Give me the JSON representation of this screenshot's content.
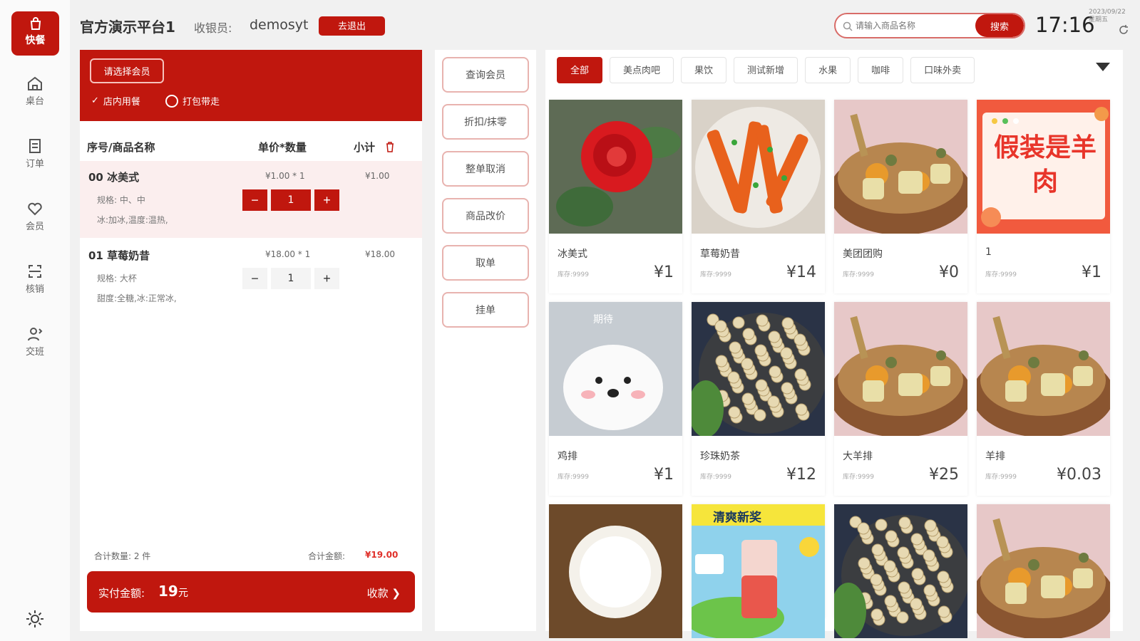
{
  "app": {
    "logo_label": "快餐",
    "title": "官方演示平台1",
    "cashier_label": "收银员:",
    "cashier_name": "demosyt",
    "logout_label": "去退出"
  },
  "nav": [
    {
      "label": "桌台",
      "icon": "home-icon"
    },
    {
      "label": "订单",
      "icon": "order-icon"
    },
    {
      "label": "会员",
      "icon": "heart-icon"
    },
    {
      "label": "核销",
      "icon": "scan-icon"
    },
    {
      "label": "交班",
      "icon": "user-switch-icon"
    }
  ],
  "search": {
    "placeholder": "请输入商品名称",
    "button_label": "搜索"
  },
  "clock": {
    "time": "17:16",
    "date": "2023/09/22",
    "weekday": "星期五"
  },
  "order": {
    "select_member_label": "请选择会员",
    "dine_in_label": "店内用餐",
    "takeaway_label": "打包带走",
    "columns": {
      "name": "序号/商品名称",
      "price_qty": "单价*数量",
      "subtotal": "小计"
    },
    "items": [
      {
        "name": "00 冰美式",
        "price_qty": "¥1.00 * 1",
        "subtotal": "¥1.00",
        "spec": "规格: 中、中",
        "note": "冰:加冰,温度:温热,",
        "qty": "1"
      },
      {
        "name": "01 草莓奶昔",
        "price_qty": "¥18.00 * 1",
        "subtotal": "¥18.00",
        "spec": "规格: 大杯",
        "note": "甜度:全糖,冰:正常冰,",
        "qty": "1"
      }
    ],
    "total_qty_label": "合计数量: 2 件",
    "total_amount_label": "合计金额:",
    "total_amount": "¥19.00",
    "pay_label": "实付金额:",
    "pay_amount": "19",
    "pay_unit": "元",
    "checkout_label": "收款 ❯"
  },
  "actions": [
    "查询会员",
    "折扣/抹零",
    "整单取消",
    "商品改价",
    "取单",
    "挂单"
  ],
  "categories": [
    "全部",
    "美点肉吧",
    "果饮",
    "测试新增",
    "水果",
    "咖啡",
    "口味外卖"
  ],
  "products": [
    {
      "name": "冰美式",
      "stock": "库存:9999",
      "price": "¥1"
    },
    {
      "name": "草莓奶昔",
      "stock": "库存:9999",
      "price": "¥14"
    },
    {
      "name": "美团团购",
      "stock": "库存:9999",
      "price": "¥0"
    },
    {
      "name": "1",
      "stock": "库存:9999",
      "price": "¥1"
    },
    {
      "name": "鸡排",
      "stock": "库存:9999",
      "price": "¥1"
    },
    {
      "name": "珍珠奶茶",
      "stock": "库存:9999",
      "price": "¥12"
    },
    {
      "name": "大羊排",
      "stock": "库存:9999",
      "price": "¥25"
    },
    {
      "name": "羊排",
      "stock": "库存:9999",
      "price": "¥0.03"
    },
    {
      "name": "",
      "stock": "",
      "price": ""
    },
    {
      "name": "",
      "stock": "",
      "price": ""
    },
    {
      "name": "",
      "stock": "",
      "price": ""
    },
    {
      "name": "",
      "stock": "",
      "price": ""
    }
  ],
  "product_images": [
    {
      "kind": "rose"
    },
    {
      "kind": "fries"
    },
    {
      "kind": "meatpot"
    },
    {
      "kind": "poster",
      "text": "假装是羊肉"
    },
    {
      "kind": "puppy",
      "text": "期待"
    },
    {
      "kind": "beans"
    },
    {
      "kind": "meatpot"
    },
    {
      "kind": "meatpot"
    },
    {
      "kind": "rice"
    },
    {
      "kind": "drink",
      "text": "清爽新奖"
    },
    {
      "kind": "beans"
    },
    {
      "kind": "meatpot"
    }
  ],
  "colors": {
    "accent": "#c0170e",
    "accent_light": "#fbeeee"
  }
}
